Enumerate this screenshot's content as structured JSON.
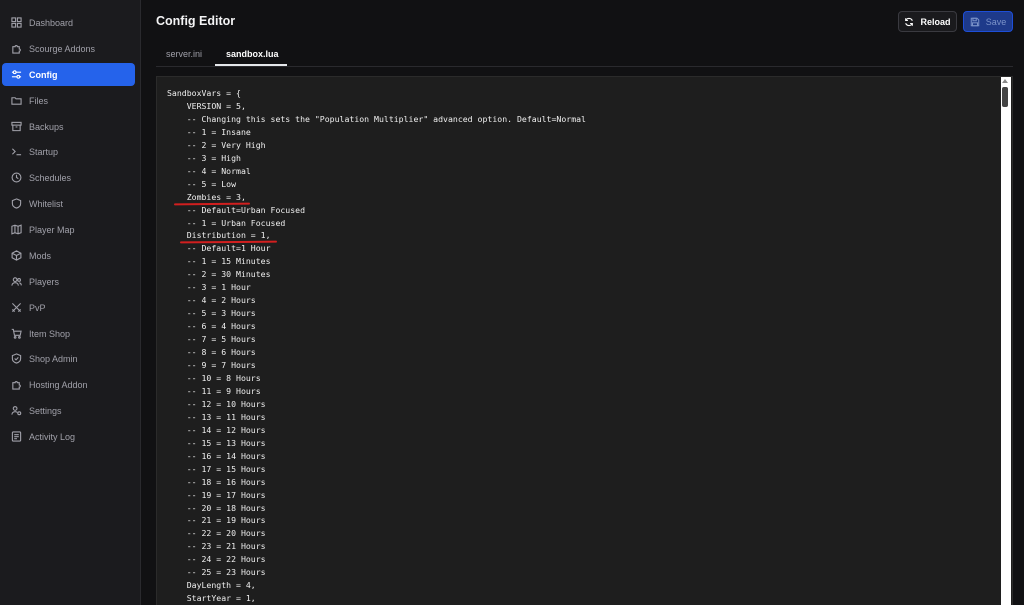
{
  "sidebar": {
    "items": [
      {
        "label": "Dashboard",
        "icon": "dashboard-icon"
      },
      {
        "label": "Scourge Addons",
        "icon": "puzzle-icon"
      },
      {
        "label": "Config",
        "icon": "sliders-icon",
        "active": true
      },
      {
        "label": "Files",
        "icon": "folder-icon"
      },
      {
        "label": "Backups",
        "icon": "archive-icon"
      },
      {
        "label": "Startup",
        "icon": "terminal-icon"
      },
      {
        "label": "Schedules",
        "icon": "clock-icon"
      },
      {
        "label": "Whitelist",
        "icon": "shield-icon"
      },
      {
        "label": "Player Map",
        "icon": "map-icon"
      },
      {
        "label": "Mods",
        "icon": "box-icon"
      },
      {
        "label": "Players",
        "icon": "users-icon"
      },
      {
        "label": "PvP",
        "icon": "swords-icon"
      },
      {
        "label": "Item Shop",
        "icon": "cart-icon"
      },
      {
        "label": "Shop Admin",
        "icon": "shield-check-icon"
      },
      {
        "label": "Hosting Addon",
        "icon": "puzzle-icon"
      },
      {
        "label": "Settings",
        "icon": "user-cog-icon"
      },
      {
        "label": "Activity Log",
        "icon": "log-icon"
      }
    ]
  },
  "header": {
    "title": "Config Editor",
    "reload_label": "Reload",
    "save_label": "Save"
  },
  "tabs": [
    {
      "label": "server.ini"
    },
    {
      "label": "sandbox.lua",
      "active": true
    }
  ],
  "editor": {
    "lines": [
      "SandboxVars = {",
      "    VERSION = 5,",
      "    -- Changing this sets the \"Population Multiplier\" advanced option. Default=Normal",
      "    -- 1 = Insane",
      "    -- 2 = Very High",
      "    -- 3 = High",
      "    -- 4 = Normal",
      "    -- 5 = Low",
      "    Zombies = 3,",
      "    -- Default=Urban Focused",
      "    -- 1 = Urban Focused",
      "    Distribution = 1,",
      "    -- Default=1 Hour",
      "    -- 1 = 15 Minutes",
      "    -- 2 = 30 Minutes",
      "    -- 3 = 1 Hour",
      "    -- 4 = 2 Hours",
      "    -- 5 = 3 Hours",
      "    -- 6 = 4 Hours",
      "    -- 7 = 5 Hours",
      "    -- 8 = 6 Hours",
      "    -- 9 = 7 Hours",
      "    -- 10 = 8 Hours",
      "    -- 11 = 9 Hours",
      "    -- 12 = 10 Hours",
      "    -- 13 = 11 Hours",
      "    -- 14 = 12 Hours",
      "    -- 15 = 13 Hours",
      "    -- 16 = 14 Hours",
      "    -- 17 = 15 Hours",
      "    -- 18 = 16 Hours",
      "    -- 19 = 17 Hours",
      "    -- 20 = 18 Hours",
      "    -- 21 = 19 Hours",
      "    -- 22 = 20 Hours",
      "    -- 23 = 21 Hours",
      "    -- 24 = 22 Hours",
      "    -- 25 = 23 Hours",
      "    DayLength = 4,",
      "    StartYear = 1,"
    ]
  },
  "colors": {
    "accent": "#2563eb",
    "annotation": "#d11f1f"
  }
}
